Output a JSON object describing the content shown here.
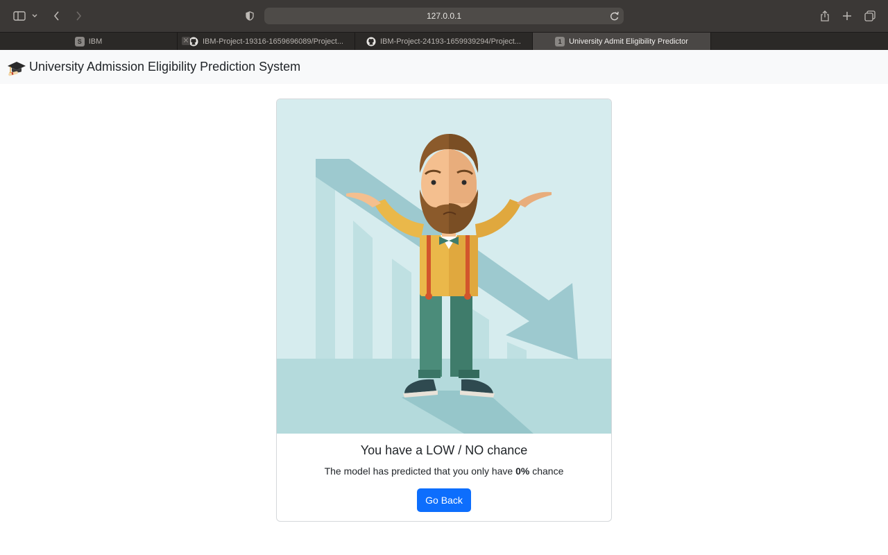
{
  "browser": {
    "url": "127.0.0.1",
    "tabs": [
      {
        "label": "IBM",
        "favicon": "S"
      },
      {
        "label": "IBM-Project-19316-1659696089/Project..."
      },
      {
        "label": "IBM-Project-24193-1659939294/Project..."
      },
      {
        "label": "University Admit Eligibility Predictor",
        "favicon": "1"
      }
    ]
  },
  "navbar": {
    "brand": "University Admission Eligibility Prediction System"
  },
  "result": {
    "title": "You have a LOW / NO chance",
    "text_before": "The model has predicted that you only have ",
    "percent": "0%",
    "text_after": " chance",
    "button": "Go Back"
  },
  "colors": {
    "primary": "#0d6efd",
    "navbar_bg": "#f8f9fa",
    "illustration_bg": "#d6ecee"
  }
}
